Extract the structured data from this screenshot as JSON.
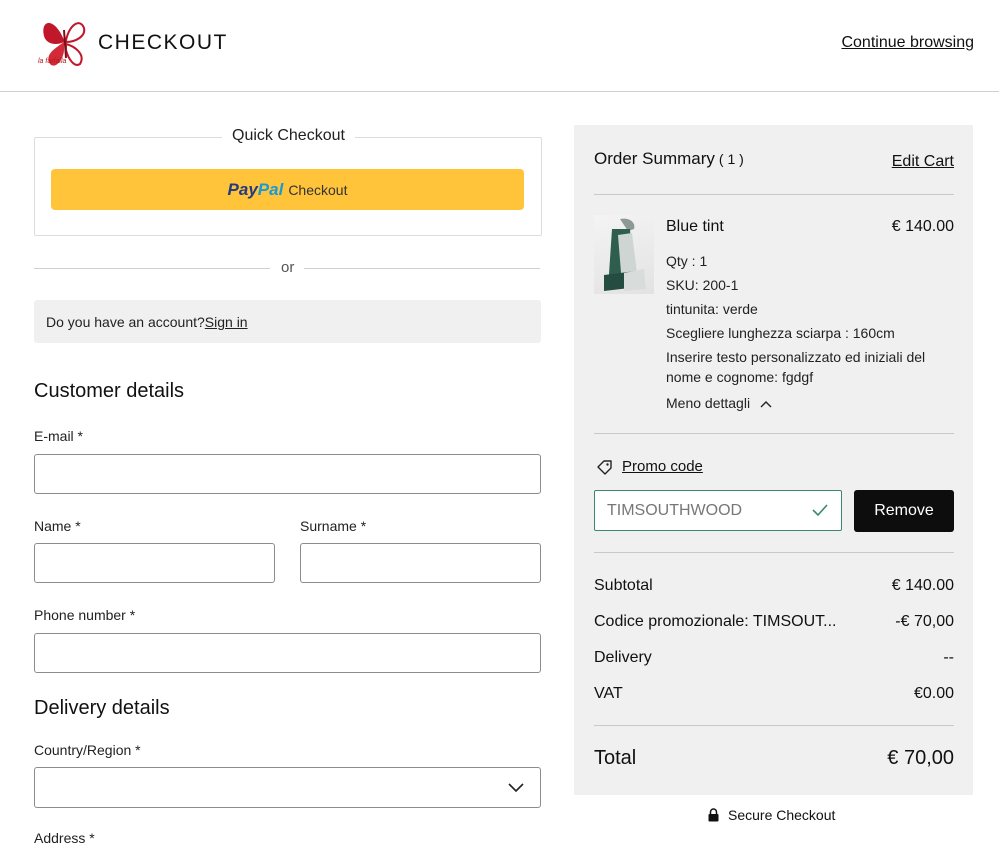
{
  "header": {
    "brand_title": "CHECKOUT",
    "logo_caption": "la farfalla",
    "continue_label": "Continue browsing"
  },
  "quick_checkout": {
    "title": "Quick Checkout",
    "paypal_part1": "Pay",
    "paypal_part2": "Pal",
    "paypal_text": "Checkout",
    "separator": "or"
  },
  "account": {
    "question": "Do you have an account?",
    "signin_label": "Sign in"
  },
  "customer_details": {
    "title": "Customer details",
    "email_label": "E-mail *",
    "email_value": "",
    "name_label": "Name *",
    "name_value": "",
    "surname_label": "Surname *",
    "surname_value": "",
    "phone_label": "Phone number *",
    "phone_value": ""
  },
  "delivery_details": {
    "title": "Delivery details",
    "country_label": "Country/Region *",
    "country_value": "",
    "address_label": "Address *"
  },
  "order_summary": {
    "title": "Order Summary",
    "count": "( 1 )",
    "edit_cart_label": "Edit Cart",
    "item": {
      "name": "Blue tint",
      "price": "€ 140.00",
      "options": [
        "Qty : 1",
        "SKU: 200-1",
        "tintunita: verde",
        "Scegliere lunghezza sciarpa : 160cm",
        "Inserire testo personalizzato ed iniziali del nome e cognome: fgdgf"
      ],
      "less_details_label": "Meno dettagli"
    },
    "promo": {
      "link_label": "Promo code",
      "value": "TIMSOUTHWOOD",
      "remove_label": "Remove"
    },
    "rows": [
      {
        "label": "Subtotal",
        "value": "€ 140.00"
      },
      {
        "label": "Codice promozionale: TIMSOUT...",
        "value": "-€ 70,00"
      },
      {
        "label": "Delivery",
        "value": "--"
      },
      {
        "label": "VAT",
        "value": "€0.00"
      }
    ],
    "total_label": "Total",
    "total_value": "€ 70,00"
  },
  "secure_checkout_label": "Secure Checkout",
  "colors": {
    "paypal_yellow": "#ffc439",
    "paypal_dark_blue": "#253b80",
    "paypal_light_blue": "#179bd7",
    "summary_bg": "#f0f0f0",
    "promo_valid_green": "#3a8a6a",
    "logo_red": "#b01a1a"
  },
  "icons": {
    "logo": "butterfly-logo-icon",
    "paypal": "paypal-logo-icon",
    "chevron_down": "chevron-down-icon",
    "chevron_up": "chevron-up-icon",
    "tag": "tag-icon",
    "check": "check-icon",
    "lock": "lock-icon"
  }
}
